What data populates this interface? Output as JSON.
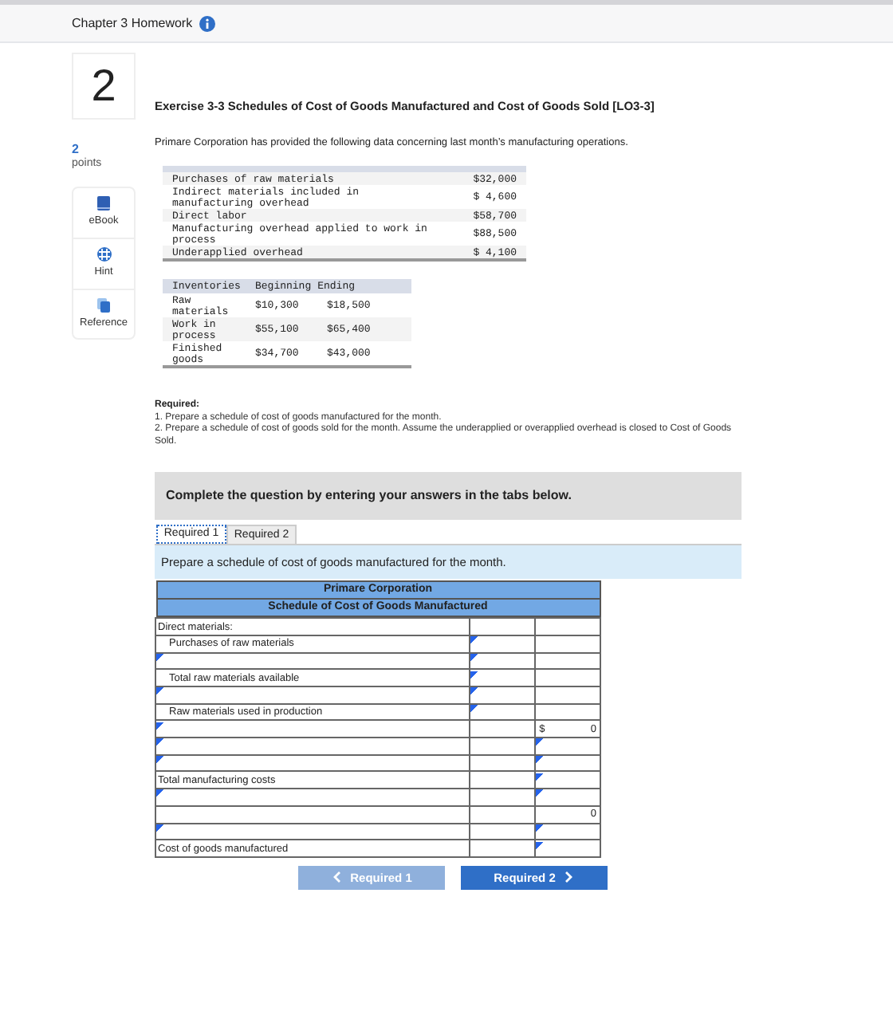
{
  "header": {
    "title": "Chapter 3 Homework"
  },
  "question": {
    "number": "2",
    "points": "2",
    "points_label": "points",
    "title": "Exercise 3-3 Schedules of Cost of Goods Manufactured and Cost of Goods Sold [LO3-3]",
    "intro": "Primare Corporation has provided the following data concerning last month’s manufacturing operations."
  },
  "sidebar": {
    "items": [
      {
        "kind": "book",
        "label": "eBook"
      },
      {
        "kind": "hint",
        "label": "Hint"
      },
      {
        "kind": "reference",
        "label": "Reference"
      }
    ]
  },
  "data_table": {
    "rows": [
      {
        "label": "Purchases of raw materials",
        "value": "$32,000"
      },
      {
        "label": "Indirect materials included in manufacturing overhead",
        "value": "$ 4,600"
      },
      {
        "label": "Direct labor",
        "value": "$58,700"
      },
      {
        "label": "Manufacturing overhead applied to work in process",
        "value": "$88,500"
      },
      {
        "label": "Underapplied overhead",
        "value": "$ 4,100"
      }
    ]
  },
  "inventory_table": {
    "columns": [
      "Inventories",
      "Beginning",
      "Ending"
    ],
    "rows": [
      [
        "Raw materials",
        "$10,300",
        "$18,500"
      ],
      [
        "Work in process",
        "$55,100",
        "$65,400"
      ],
      [
        "Finished goods",
        "$34,700",
        "$43,000"
      ]
    ]
  },
  "required": {
    "heading": "Required:",
    "items": [
      "1. Prepare a schedule of cost of goods manufactured for the month.",
      "2. Prepare a schedule of cost of goods sold for the month. Assume the underapplied or overapplied overhead is closed to Cost of Goods Sold."
    ]
  },
  "instruction": "Complete the question by entering your answers in the tabs below.",
  "tabs": [
    {
      "label": "Required 1",
      "selected": true
    },
    {
      "label": "Required 2",
      "selected": false
    }
  ],
  "task": "Prepare a schedule of cost of goods manufactured for the month.",
  "schedule": {
    "title": "Primare Corporation",
    "subtitle": "Schedule of Cost of Goods Manufactured",
    "rows": [
      {
        "label": "Direct materials:",
        "indent": false,
        "col_1_input": false,
        "col_2_input": false
      },
      {
        "label": "Purchases of raw materials",
        "indent": true,
        "col_1_input": true,
        "col_2_input": false
      },
      {
        "label_input": true,
        "col_1_input": true,
        "col_2_input": false
      },
      {
        "label": "Total raw materials available",
        "indent": true,
        "col_1_input": true,
        "col_2_input": false
      },
      {
        "label_input": true,
        "col_1_input": true,
        "col_2_input": false
      },
      {
        "label": "Raw materials used in production",
        "indent": true,
        "col_1_input": true,
        "col_2_input": false
      },
      {
        "label_input": true,
        "col_1_input": false,
        "col_2_input": false,
        "currency": "$",
        "value": "0"
      },
      {
        "label_input": true,
        "col_1_input": false,
        "col_2_input": true
      },
      {
        "label_input": true,
        "col_1_input": false,
        "col_2_input": true
      },
      {
        "label": "Total manufacturing costs",
        "indent": false,
        "col_1_input": false,
        "col_2_input": true
      },
      {
        "label_input": true,
        "col_1_input": false,
        "col_2_input": true
      },
      {
        "label_input": false,
        "col_1_input": false,
        "col_2_input": false,
        "value": "0"
      },
      {
        "label_input": true,
        "col_1_input": false,
        "col_2_input": true
      },
      {
        "label": "Cost of goods manufactured",
        "indent": false,
        "col_1_input": false,
        "col_2_input": true
      }
    ]
  },
  "nav": [
    {
      "label": "Required 1",
      "kind": "prev",
      "disabled": true
    },
    {
      "label": "Required 2",
      "kind": "next",
      "disabled": false
    }
  ]
}
